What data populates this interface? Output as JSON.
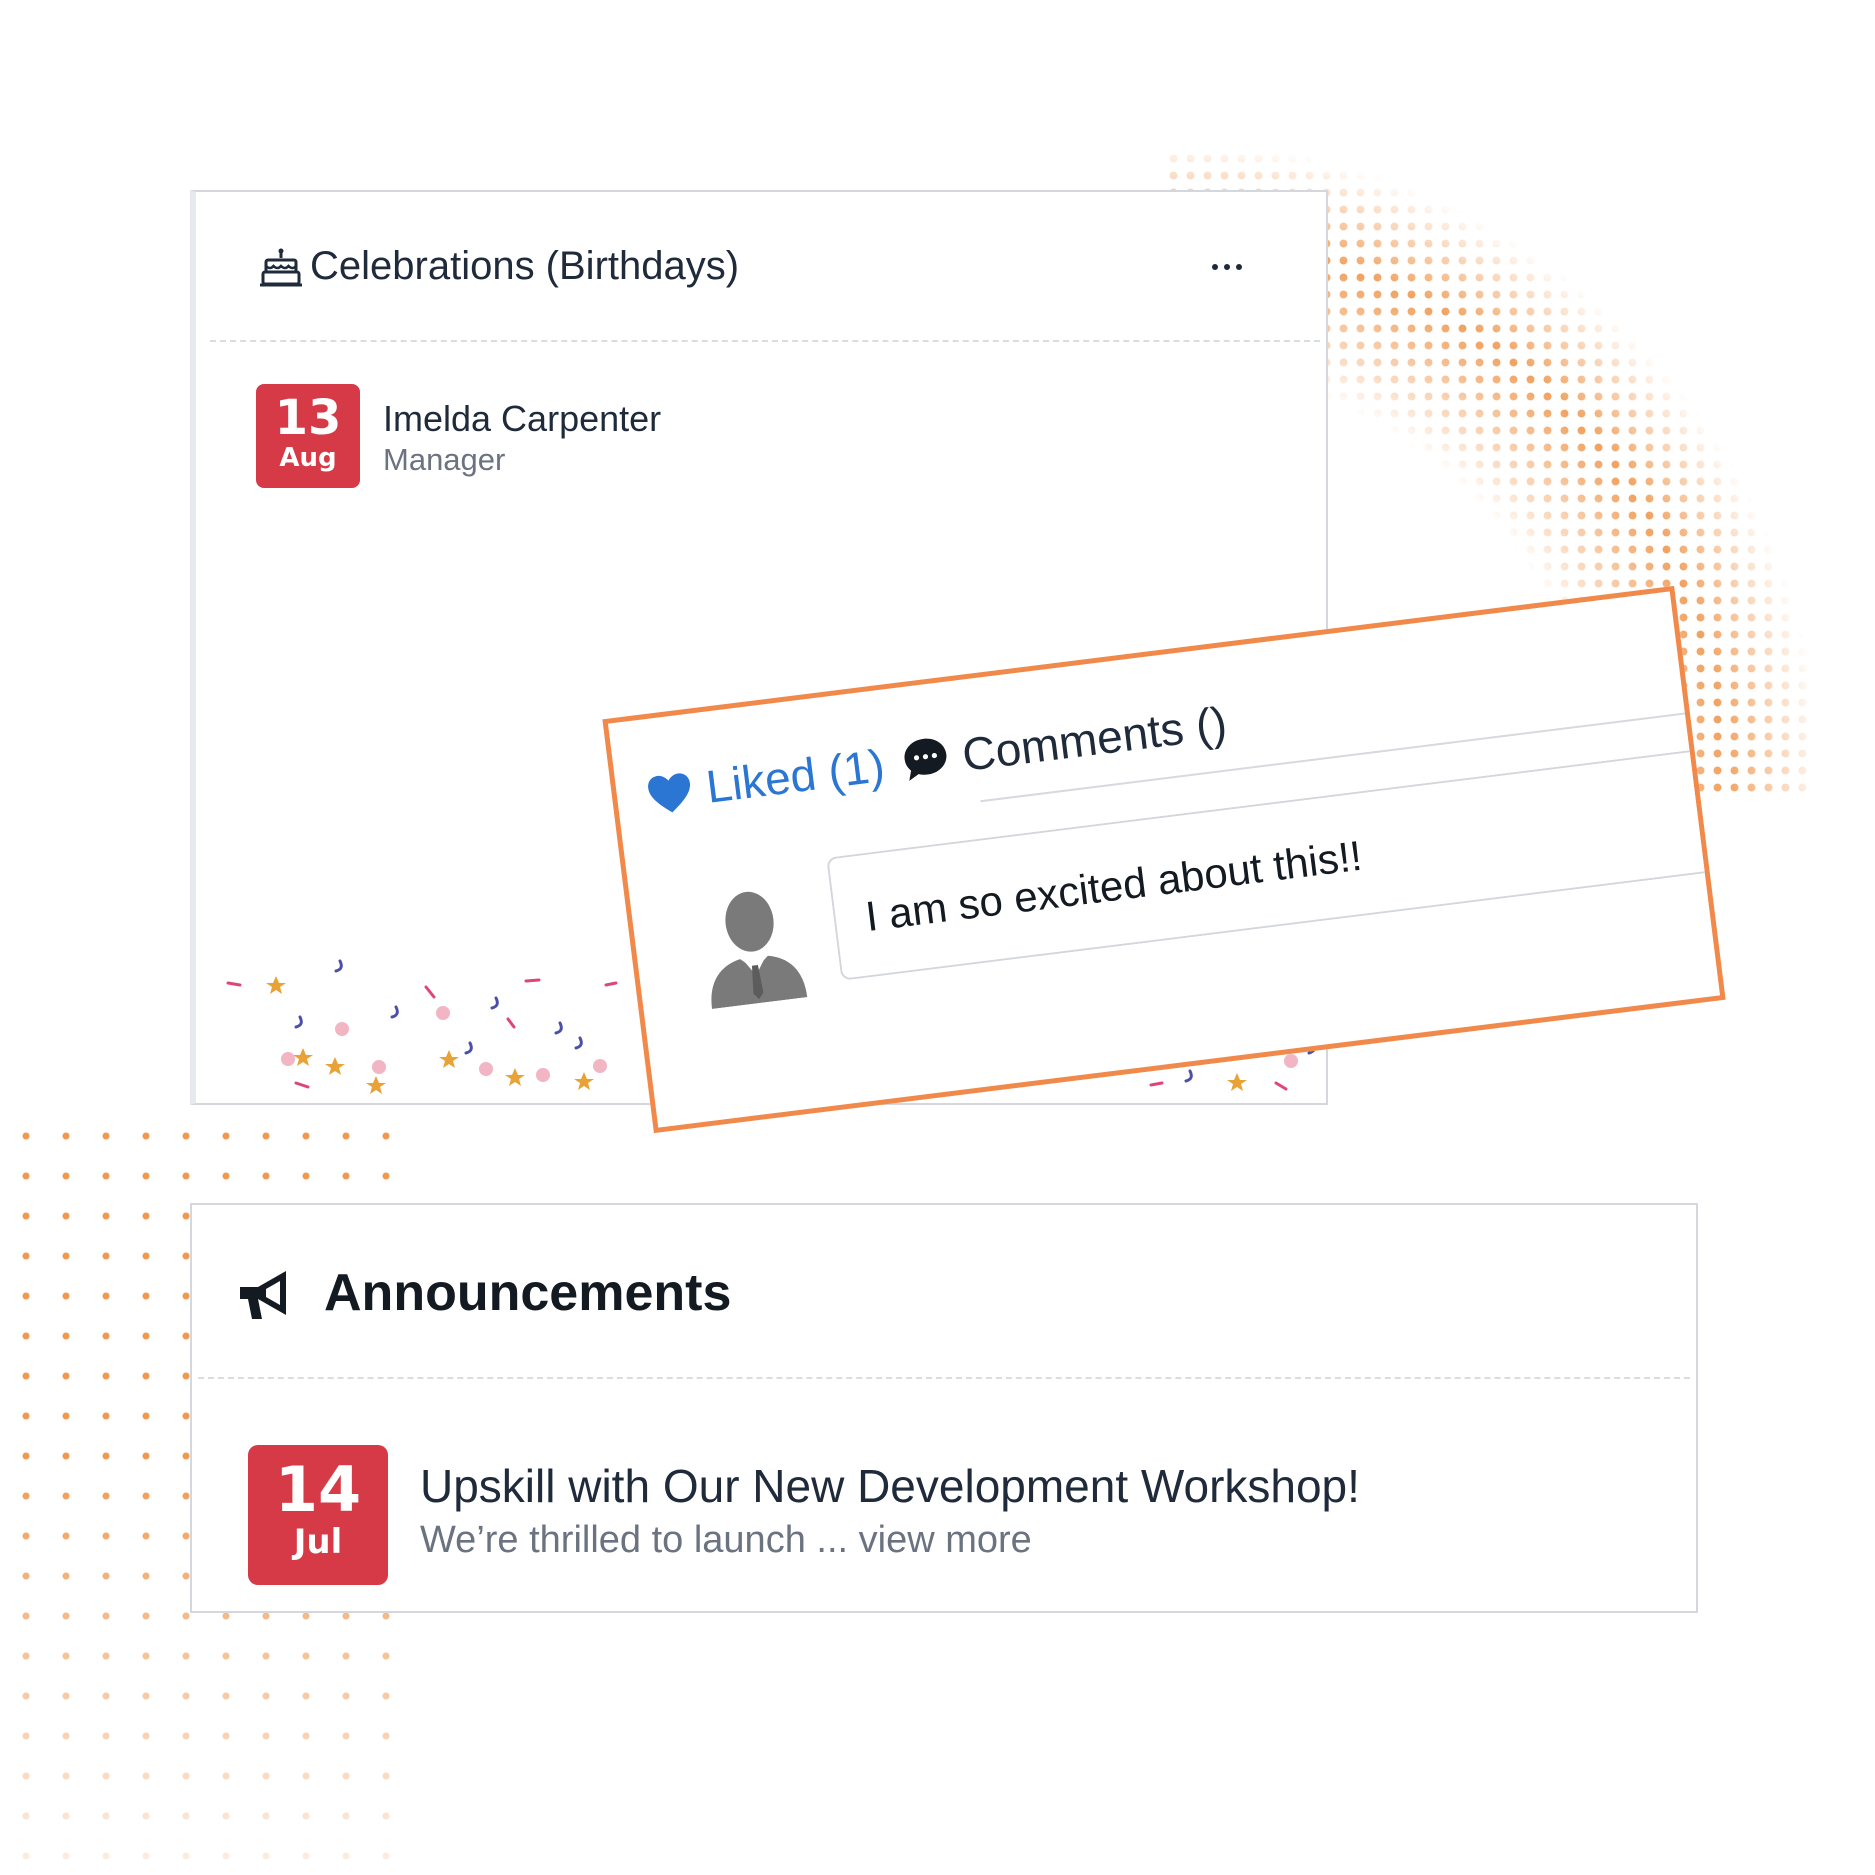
{
  "celebrations": {
    "title": "Celebrations (Birthdays)",
    "icon": "cake-icon",
    "more_icon": "more-horizontal-icon",
    "person": {
      "day": "13",
      "month": "Aug",
      "name": "Imelda Carpenter",
      "role": "Manager"
    }
  },
  "comment_card": {
    "liked_label": "Liked (1)",
    "comments_label": "Comments ()",
    "comment_text": "I am so excited about this!!",
    "icons": [
      "heart-icon",
      "chat-bubble-icon",
      "avatar-icon"
    ]
  },
  "announcements": {
    "title": "Announcements",
    "icon": "megaphone-icon",
    "item": {
      "day": "14",
      "month": "Jul",
      "headline": "Upskill with Our New Development Workshop!",
      "snippet": "We’re thrilled to launch ...",
      "view_more": "view more"
    }
  },
  "colors": {
    "accent_orange": "#f0894a",
    "badge_red": "#d63a46",
    "liked_blue": "#2a76d2"
  }
}
